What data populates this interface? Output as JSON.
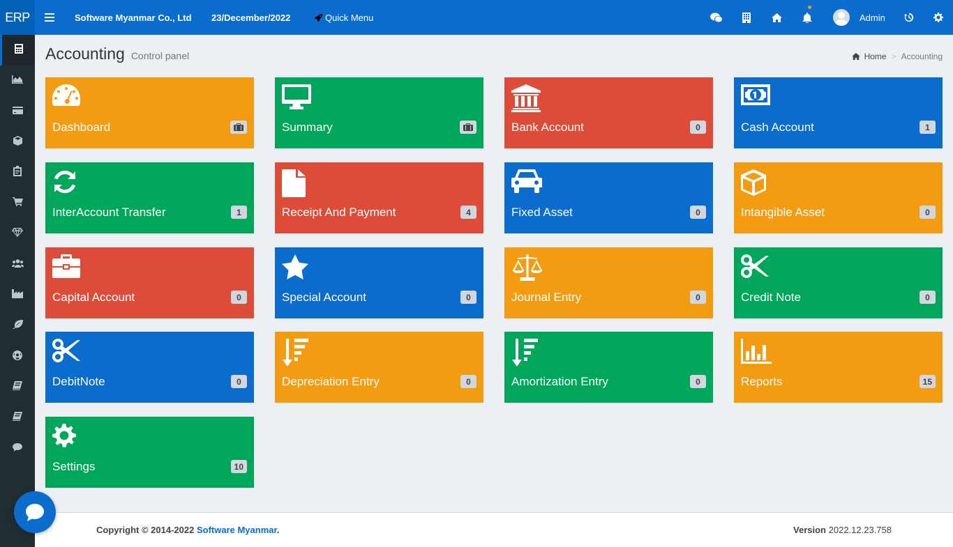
{
  "header": {
    "logo": "ERP",
    "company": "Software Myanmar Co., Ltd",
    "date": "23/December/2022",
    "quick_menu": "Quick Menu",
    "user": "Admin",
    "icons": [
      "menu-icon",
      "rocket-icon",
      "wechat-icon",
      "building-icon",
      "home-icon",
      "bell-icon",
      "history-icon",
      "gear-icon"
    ]
  },
  "sidebar": {
    "items": [
      "calculator-icon",
      "area-chart-icon",
      "credit-card-icon",
      "cube-icon",
      "clipboard-icon",
      "shopping-cart-icon",
      "diamond-icon",
      "users-icon",
      "industry-icon",
      "leaf-icon",
      "futbol-icon",
      "book-icon",
      "book-icon",
      "comment-icon"
    ]
  },
  "page": {
    "title": "Accounting",
    "subtitle": "Control panel"
  },
  "breadcrumb": {
    "home": "Home",
    "current": "Accounting"
  },
  "tiles": [
    {
      "label": "Dashboard",
      "badge": "",
      "color": "#f39c12",
      "icon": "dashboard-icon"
    },
    {
      "label": "Summary",
      "badge": "",
      "color": "#00a65a",
      "icon": "monitor-icon"
    },
    {
      "label": "Bank Account",
      "badge": "0",
      "color": "#dd4b39",
      "icon": "bank-icon"
    },
    {
      "label": "Cash Account",
      "badge": "1",
      "color": "#0a6ccc",
      "icon": "money-icon"
    },
    {
      "label": "InterAccount Transfer",
      "badge": "1",
      "color": "#00a65a",
      "icon": "refresh-icon"
    },
    {
      "label": "Receipt And Payment",
      "badge": "4",
      "color": "#dd4b39",
      "icon": "file-icon"
    },
    {
      "label": "Fixed Asset",
      "badge": "0",
      "color": "#0a6ccc",
      "icon": "car-icon"
    },
    {
      "label": "Intangible Asset",
      "badge": "0",
      "color": "#f39c12",
      "icon": "cube-icon"
    },
    {
      "label": "Capital Account",
      "badge": "0",
      "color": "#dd4b39",
      "icon": "briefcase-icon"
    },
    {
      "label": "Special Account",
      "badge": "0",
      "color": "#0a6ccc",
      "icon": "star-icon"
    },
    {
      "label": "Journal Entry",
      "badge": "0",
      "color": "#f39c12",
      "icon": "balance-scale-icon"
    },
    {
      "label": "Credit Note",
      "badge": "0",
      "color": "#00a65a",
      "icon": "scissors-icon"
    },
    {
      "label": "DebitNote",
      "badge": "0",
      "color": "#0a6ccc",
      "icon": "scissors-icon"
    },
    {
      "label": "Depreciation Entry",
      "badge": "0",
      "color": "#f39c12",
      "icon": "sort-amount-desc-icon"
    },
    {
      "label": "Amortization Entry",
      "badge": "0",
      "color": "#00a65a",
      "icon": "sort-amount-desc-icon"
    },
    {
      "label": "Reports",
      "badge": "15",
      "color": "#f39c12",
      "icon": "bar-chart-icon"
    },
    {
      "label": "Settings",
      "badge": "10",
      "color": "#00a65a",
      "icon": "gear-icon"
    }
  ],
  "footer": {
    "copyright": "Copyright © 2014-2022 ",
    "company_link": "Software Myanmar",
    "period": ".",
    "version_label": "Version",
    "version": "2022.12.23.758"
  }
}
